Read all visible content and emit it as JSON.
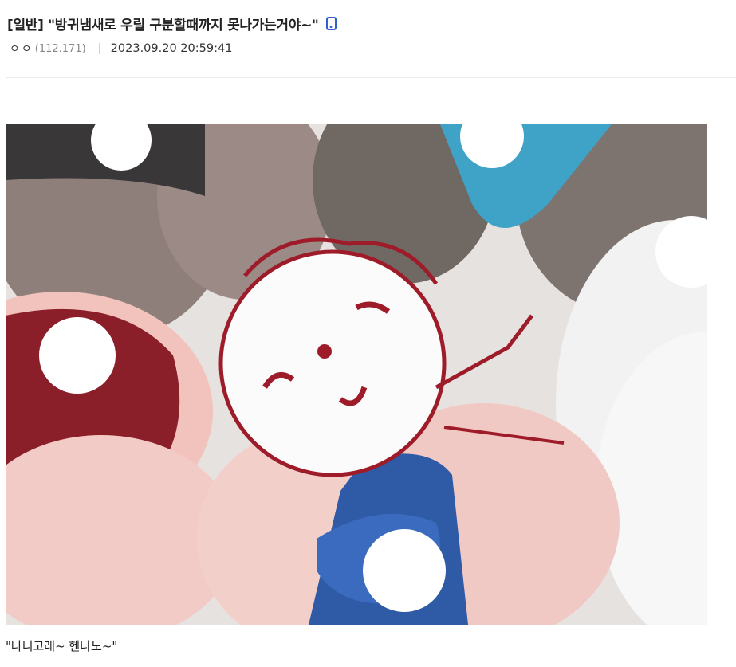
{
  "post": {
    "title": "[일반] \"방귀냄새로 우릴 구분할때까지 못나가는거야~\"",
    "device_icon": "mobile-icon",
    "author_nick": "ㅇㅇ",
    "author_ip": "(112.171)",
    "date": "2023.09.20 20:59:41"
  },
  "content": {
    "image_alt": "illustration",
    "caption": "\"나니고래~ 헨나노~\""
  },
  "colors": {
    "mobile_icon": "#2f5fd0",
    "title": "#222222",
    "ip": "#888888"
  }
}
